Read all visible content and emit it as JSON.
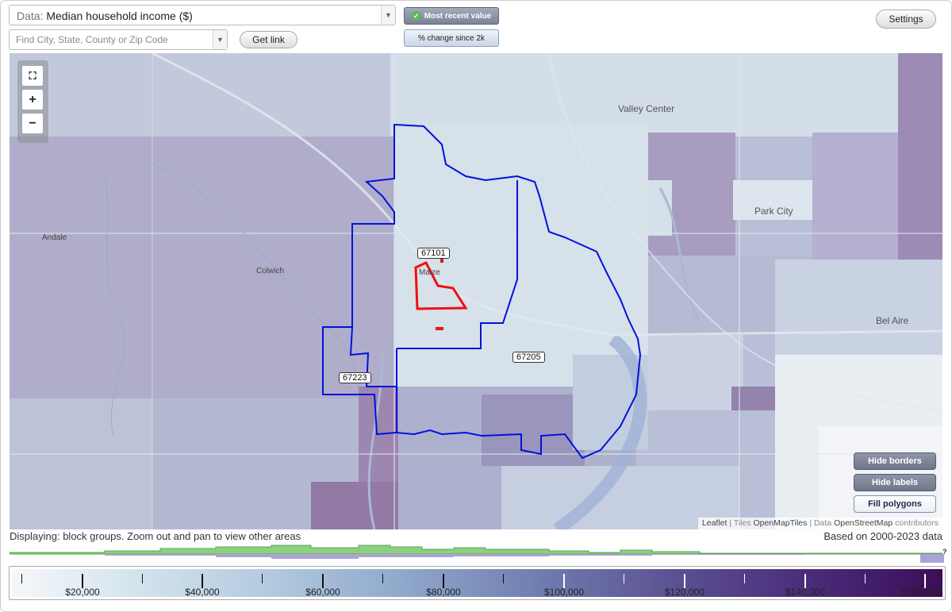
{
  "controls": {
    "data_prefix": "Data: ",
    "data_value": "Median household income ($)",
    "search_placeholder": "Find City, State, County or Zip Code",
    "get_link_label": "Get link",
    "mode_recent_label": "Most recent value",
    "mode_change_label": "% change since 2k",
    "settings_label": "Settings"
  },
  "map": {
    "zoom_icons": {
      "fullscreen": "fullscreen-icon",
      "zoom_in": "+",
      "zoom_out": "−"
    },
    "zip_labels": [
      "67101",
      "67205",
      "67223"
    ],
    "places": [
      "Valley Center",
      "Park City",
      "Andale",
      "Colwich",
      "Bel Aire",
      "Maize"
    ],
    "toggles": {
      "hide_borders": "Hide borders",
      "hide_labels": "Hide labels",
      "fill_polygons": "Fill polygons"
    },
    "attribution": {
      "leaflet": "Leaflet",
      "sep1": " | Tiles ",
      "tiles": "OpenMapTiles",
      "sep2": " | Data ",
      "data": "OpenStreetMap",
      "suffix": " contributors"
    },
    "highlight_colors": {
      "zip_border": "#0011dd",
      "selected": "#ee1111"
    }
  },
  "status": {
    "displaying": "Displaying: block groups. Zoom out and pan to view other areas",
    "based_on": "Based on 2000-2023 data"
  },
  "histogram": {
    "unknown_marker": "?"
  },
  "legend": {
    "labels": [
      "$20,000",
      "$40,000",
      "$60,000",
      "$80,000",
      "$100,000",
      "$120,000",
      "$140,000",
      "$160,000"
    ]
  }
}
